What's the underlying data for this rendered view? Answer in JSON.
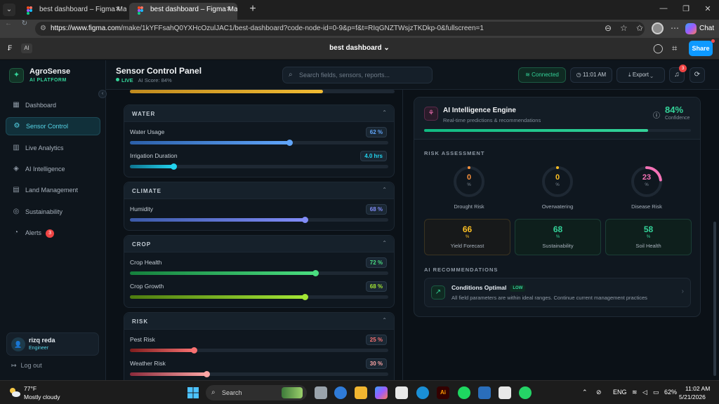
{
  "browser": {
    "tabs": [
      {
        "title": "best dashboard – Figma Make",
        "active": false
      },
      {
        "title": "best dashboard – Figma Make",
        "active": true
      }
    ],
    "url_host": "https://www.figma.com",
    "url_path": "/make/1kYFFsahQ0YXHcOzulJAC1/best-dashboard?code-node-id=0-9&p=f&t=RIqGNZTWsjzTKDkp-0&fullscreen=1",
    "chat_label": "Chat"
  },
  "figma": {
    "ai_label": "AI",
    "file_title": "best dashboard",
    "share_label": "Share"
  },
  "sidebar": {
    "brand_name": "AgroSense",
    "brand_sub": "AI PLATFORM",
    "items": [
      {
        "label": "Dashboard",
        "icon": "grid-icon",
        "active": false
      },
      {
        "label": "Sensor Control",
        "icon": "sliders-icon",
        "active": true
      },
      {
        "label": "Live Analytics",
        "icon": "chart-icon",
        "active": false
      },
      {
        "label": "AI Intelligence",
        "icon": "brain-icon",
        "active": false
      },
      {
        "label": "Land Management",
        "icon": "map-icon",
        "active": false
      },
      {
        "label": "Sustainability",
        "icon": "globe-icon",
        "active": false
      },
      {
        "label": "Alerts",
        "icon": "bell-icon",
        "active": false,
        "badge": "3"
      }
    ],
    "user": {
      "name": "rizq reda",
      "role": "Engineer",
      "initial": "👤"
    },
    "logout_label": "Log out"
  },
  "header": {
    "title": "Sensor Control Panel",
    "live_label": "LIVE",
    "ai_score": "AI Score: 84%",
    "search_placeholder": "Search fields, sensors, reports...",
    "connected_label": "Connected",
    "time_label": "11:01 AM",
    "export_label": "Export",
    "notifications_count": "3"
  },
  "sensors": {
    "top_partial_fill": 0.73,
    "groups": [
      {
        "title": "WATER",
        "metrics": [
          {
            "label": "Water Usage",
            "value": "62 %",
            "fraction": 0.62,
            "color": "#60a5fa",
            "color_from": "#2b5fa8"
          },
          {
            "label": "Irrigation Duration",
            "value": "4.0 hrs",
            "fraction": 0.17,
            "color": "#22d3ee",
            "color_from": "#0e7490"
          }
        ]
      },
      {
        "title": "CLIMATE",
        "metrics": [
          {
            "label": "Humidity",
            "value": "68 %",
            "fraction": 0.68,
            "color": "#818cf8",
            "color_from": "#3b5aa8"
          }
        ]
      },
      {
        "title": "CROP",
        "metrics": [
          {
            "label": "Crop Health",
            "value": "72 %",
            "fraction": 0.72,
            "color": "#4ade80",
            "color_from": "#15803d"
          },
          {
            "label": "Crop Growth",
            "value": "68 %",
            "fraction": 0.68,
            "color": "#a3e635",
            "color_from": "#4d7c0f"
          }
        ]
      },
      {
        "title": "RISK",
        "metrics": [
          {
            "label": "Pest Risk",
            "value": "25 %",
            "fraction": 0.25,
            "color": "#f87171",
            "color_from": "#7f1d1d"
          },
          {
            "label": "Weather Risk",
            "value": "30 %",
            "fraction": 0.3,
            "color": "#fca5a5",
            "color_from": "#8a2a3a"
          }
        ]
      }
    ]
  },
  "ai": {
    "title": "AI Intelligence Engine",
    "subtitle": "Real-time predictions & recommendations",
    "confidence_value": "84%",
    "confidence_label": "Confidence",
    "confidence_fraction": 0.84,
    "risk_title": "RISK ASSESSMENT",
    "risks": [
      {
        "label": "Drought Risk",
        "value": "0",
        "fraction": 0.0,
        "color": "#fb923c"
      },
      {
        "label": "Overwatering",
        "value": "0",
        "fraction": 0.0,
        "color": "#fbbf24"
      },
      {
        "label": "Disease Risk",
        "value": "23",
        "fraction": 0.23,
        "color": "#f472b6"
      }
    ],
    "scores": [
      {
        "label": "Yield Forecast",
        "value": "66",
        "color": "#fbbf24"
      },
      {
        "label": "Sustainability",
        "value": "68",
        "color": "#34d399"
      },
      {
        "label": "Soil Health",
        "value": "58",
        "color": "#34d399"
      }
    ],
    "rec_title": "AI RECOMMENDATIONS",
    "recommendation": {
      "title": "Conditions Optimal",
      "badge": "LOW",
      "description": "All field parameters are within ideal ranges. Continue current management practices"
    }
  },
  "taskbar": {
    "temp": "77°F",
    "weather": "Mostly cloudy",
    "search_label": "Search",
    "lang": "ENG",
    "battery": "62%",
    "time": "11:02 AM",
    "date": "5/21/2026"
  }
}
